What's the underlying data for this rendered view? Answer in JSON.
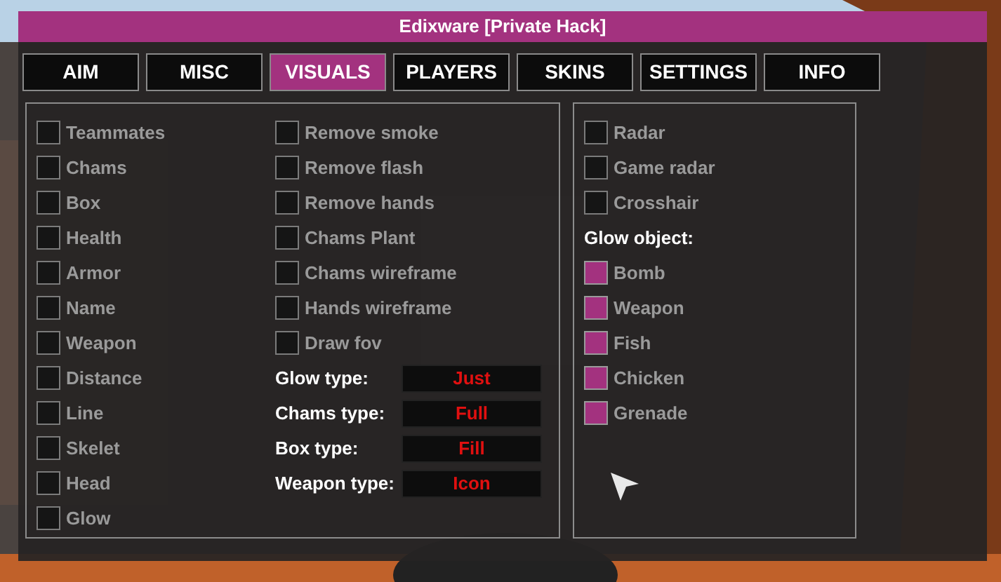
{
  "window": {
    "title": "Edixware [Private Hack]"
  },
  "tabs": [
    {
      "label": "AIM",
      "selected": false
    },
    {
      "label": "MISC",
      "selected": false
    },
    {
      "label": "VISUALS",
      "selected": true
    },
    {
      "label": "PLAYERS",
      "selected": false
    },
    {
      "label": "SKINS",
      "selected": false
    },
    {
      "label": "SETTINGS",
      "selected": false
    },
    {
      "label": "INFO",
      "selected": false
    }
  ],
  "player_options": [
    {
      "label": "Teammates",
      "checked": false
    },
    {
      "label": "Chams",
      "checked": false
    },
    {
      "label": "Box",
      "checked": false
    },
    {
      "label": "Health",
      "checked": false
    },
    {
      "label": "Armor",
      "checked": false
    },
    {
      "label": "Name",
      "checked": false
    },
    {
      "label": "Weapon",
      "checked": false
    },
    {
      "label": "Distance",
      "checked": false
    },
    {
      "label": "Line",
      "checked": false
    },
    {
      "label": "Skelet",
      "checked": false
    },
    {
      "label": "Head",
      "checked": false
    },
    {
      "label": "Glow",
      "checked": false
    }
  ],
  "effect_options": [
    {
      "label": "Remove smoke",
      "checked": false
    },
    {
      "label": "Remove flash",
      "checked": false
    },
    {
      "label": "Remove hands",
      "checked": false
    },
    {
      "label": "Chams Plant",
      "checked": false
    },
    {
      "label": "Chams wireframe",
      "checked": false
    },
    {
      "label": "Hands wireframe",
      "checked": false
    },
    {
      "label": "Draw fov",
      "checked": false
    }
  ],
  "type_settings": [
    {
      "label": "Glow type:",
      "value": "Just"
    },
    {
      "label": "Chams type:",
      "value": "Full"
    },
    {
      "label": "Box type:",
      "value": "Fill"
    },
    {
      "label": "Weapon type:",
      "value": "Icon"
    }
  ],
  "misc_options": [
    {
      "label": "Radar",
      "checked": false
    },
    {
      "label": "Game radar",
      "checked": false
    },
    {
      "label": "Crosshair",
      "checked": false
    }
  ],
  "glow_object": {
    "heading": "Glow object:",
    "items": [
      {
        "label": "Bomb",
        "checked": true
      },
      {
        "label": "Weapon",
        "checked": true
      },
      {
        "label": "Fish",
        "checked": true
      },
      {
        "label": "Chicken",
        "checked": true
      },
      {
        "label": "Grenade",
        "checked": true
      }
    ]
  }
}
